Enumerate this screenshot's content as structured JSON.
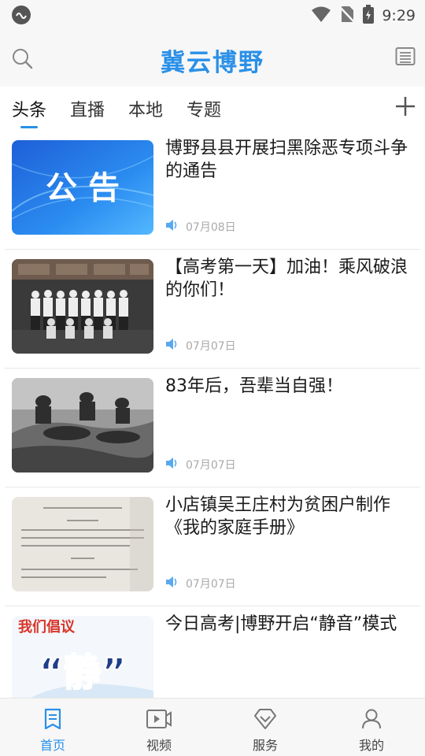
{
  "status_bar": {
    "time": "9:29",
    "icons": [
      "app-notification-icon",
      "wifi-icon",
      "no-sim-icon",
      "battery-icon"
    ]
  },
  "header": {
    "title": "冀云博野",
    "left_icon": "search-icon",
    "right_icon": "news-list-icon"
  },
  "tabs": [
    {
      "label": "头条",
      "active": true
    },
    {
      "label": "直播",
      "active": false
    },
    {
      "label": "本地",
      "active": false
    },
    {
      "label": "专题",
      "active": false
    }
  ],
  "feed": [
    {
      "title": "博野县县开展扫黑除恶专项斗争的通告",
      "date": "07月08日",
      "thumb_text": "公  告"
    },
    {
      "title": "【高考第一天】加油！乘风破浪的你们！",
      "date": "07月07日"
    },
    {
      "title": "83年后，吾辈当自强！",
      "date": "07月07日"
    },
    {
      "title": "小店镇吴王庄村为贫困户制作《我的家庭手册》",
      "date": "07月07日"
    },
    {
      "title": "今日高考|博野开启“静音”模式",
      "date": "",
      "thumb_text": "我们倡议",
      "thumb_big": "“静”"
    }
  ],
  "bottom_nav": [
    {
      "label": "首页",
      "icon": "home-news-icon",
      "active": true
    },
    {
      "label": "视频",
      "icon": "video-icon",
      "active": false
    },
    {
      "label": "服务",
      "icon": "service-diamond-icon",
      "active": false
    },
    {
      "label": "我的",
      "icon": "user-icon",
      "active": false
    }
  ],
  "colors": {
    "accent": "#2a90e8",
    "meta_text": "#aaaaaa",
    "background": "#f7f7f7"
  }
}
